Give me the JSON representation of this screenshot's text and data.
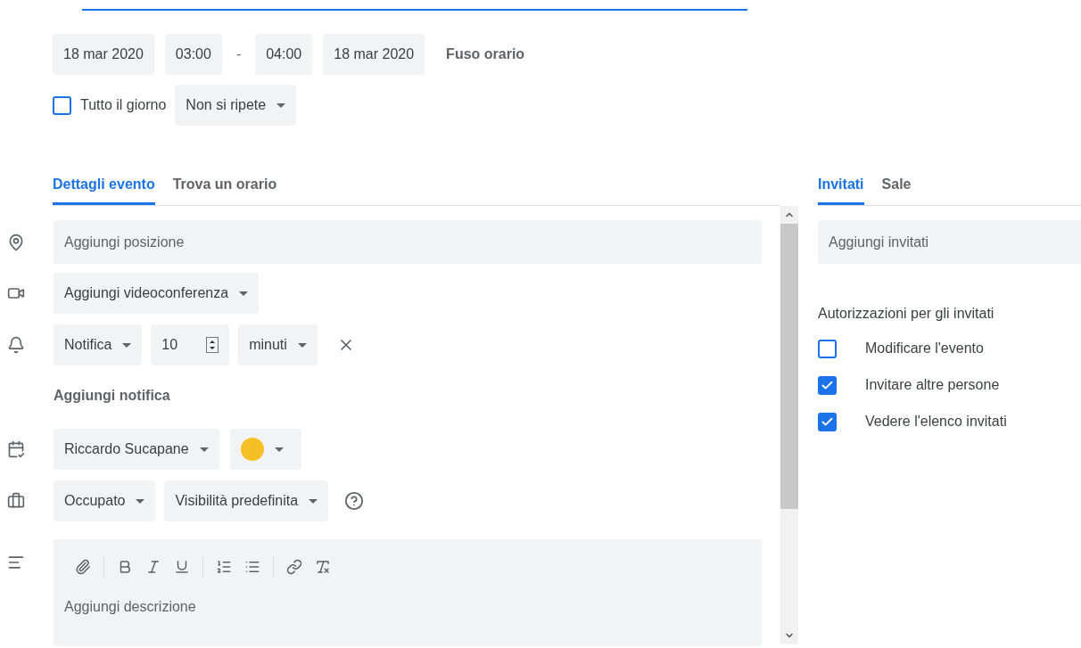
{
  "datetime": {
    "start_date": "18 mar 2020",
    "start_time": "03:00",
    "separator": "-",
    "end_time": "04:00",
    "end_date": "18 mar 2020",
    "timezone": "Fuso orario"
  },
  "all_day": {
    "label": "Tutto il giorno",
    "checked": false
  },
  "repeat": {
    "value": "Non si ripete"
  },
  "tabs": [
    {
      "label": "Dettagli evento",
      "selected": true
    },
    {
      "label": "Trova un orario",
      "selected": false
    }
  ],
  "location": {
    "placeholder": "Aggiungi posizione"
  },
  "conference": {
    "label": "Aggiungi videoconferenza"
  },
  "notification": {
    "type": "Notifica",
    "amount": "10",
    "unit": "minuti",
    "add_label": "Aggiungi notifica"
  },
  "calendar": {
    "owner": "Riccardo Sucapane",
    "color": "#f6bf26"
  },
  "availability": {
    "status": "Occupato",
    "visibility": "Visibilità predefinita"
  },
  "description": {
    "placeholder": "Aggiungi descrizione"
  },
  "guest_tabs": [
    {
      "label": "Invitati",
      "selected": true
    },
    {
      "label": "Sale",
      "selected": false
    }
  ],
  "guests": {
    "placeholder": "Aggiungi invitati",
    "permissions_title": "Autorizzazioni per gli invitati"
  },
  "permissions": [
    {
      "label": "Modificare l'evento",
      "checked": false
    },
    {
      "label": "Invitare altre persone",
      "checked": true
    },
    {
      "label": "Vedere l'elenco invitati",
      "checked": true
    }
  ]
}
